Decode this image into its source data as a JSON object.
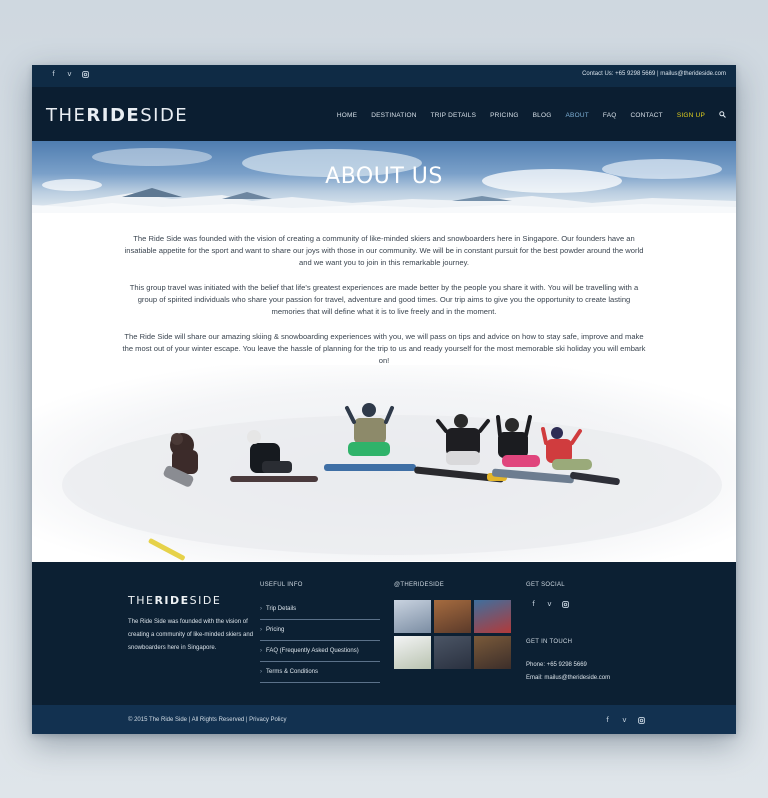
{
  "topbar": {
    "social_icons": [
      "facebook-icon",
      "vimeo-icon",
      "instagram-icon"
    ],
    "contact": "Contact Us: +65 9298 5669 | mailus@therideside.com"
  },
  "header": {
    "logo_light_1": "THE",
    "logo_bold": "RIDE",
    "logo_light_2": "SIDE",
    "nav": [
      "HOME",
      "DESTINATION",
      "TRIP DETAILS",
      "PRICING",
      "BLOG",
      "ABOUT",
      "FAQ",
      "CONTACT",
      "SIGN UP"
    ],
    "active": "ABOUT"
  },
  "hero": {
    "title": "ABOUT US"
  },
  "content": {
    "p1": "The Ride Side was founded with the vision of creating a community of like-minded skiers and snowboarders here in Singapore. Our founders have an insatiable appetite for the sport and want to share our joys with those in our community. We will be in constant pursuit for the best powder around the world and we want you to join in this remarkable journey.",
    "p2": "This group travel was initiated with the belief that life's greatest experiences are made better by the people you share it with. You will be travelling with a group of spirited individuals who share your passion for travel, adventure and good times. Our trip aims to give you the opportunity to create lasting memories that will define what it is to live freely and in the moment.",
    "p3": "The Ride Side will share our amazing skiing & snowboarding experiences with you, we will pass on tips and advice on how to stay safe, improve and make the most out of your winter escape. You leave the hassle of planning for the trip to us and ready yourself for the most memorable ski holiday you will embark on!"
  },
  "footer": {
    "logo_light_1": "THE",
    "logo_bold": "RIDE",
    "logo_light_2": "SIDE",
    "description": "The Ride Side was founded with the vision of creating a community of like-minded skiers and snowboarders here in Singapore.",
    "useful_info_heading": "USEFUL INFO",
    "useful_links": [
      "Trip Details",
      "Pricing",
      "FAQ (Frequently Asked Questions)",
      "Terms & Conditions"
    ],
    "instagram_heading": "@THERIDESIDE",
    "get_social_heading": "GET SOCIAL",
    "get_in_touch_heading": "GET IN TOUCH",
    "phone": "Phone: +65 9298 5669",
    "email": "Email: mailus@therideside.com"
  },
  "bottombar": {
    "copyright": "© 2015 The Ride Side | All Rights Reserved | Privacy Policy"
  },
  "colors": {
    "navy": "#0b1e31",
    "topbar": "#0f2b45",
    "active_nav": "#7fb2d8",
    "signup": "#e3d21e"
  }
}
